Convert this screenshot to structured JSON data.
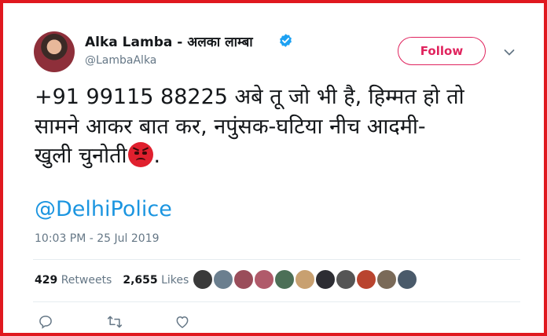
{
  "tweet": {
    "author": {
      "display_name": "Alka Lamba - अलका लाम्बा",
      "handle": "@LambaAlka",
      "verified": true
    },
    "follow_label": "Follow",
    "text_lines": [
      "+91 99115 88225 अबे तू जो भी है, हिम्मत हो तो",
      "सामने आकर बात कर, नपुंसक-घटिया नीच आदमी-",
      "खुली चुनोती"
    ],
    "text_suffix": ".",
    "emoji": "angry-face-icon",
    "mention": "@DelhiPolice",
    "timestamp": "10:03 PM - 25 Jul 2019",
    "retweets_count": "429",
    "retweets_label": "Retweets",
    "likes_count": "2,655",
    "likes_label": "Likes",
    "liker_avatar_colors": [
      "#3a3a3a",
      "#6b7f8f",
      "#9a4d5a",
      "#b05a6a",
      "#4c6f57",
      "#c8a070",
      "#2d2d33",
      "#555555",
      "#b9442f",
      "#7a6a58",
      "#4a5a6a"
    ],
    "actions": [
      "reply-icon",
      "retweet-icon",
      "like-icon"
    ]
  },
  "colors": {
    "frame_border": "#e0181f",
    "accent_follow": "#e0245e",
    "link": "#1b95e0",
    "verified": "#1da1f2",
    "muted": "#657786"
  }
}
